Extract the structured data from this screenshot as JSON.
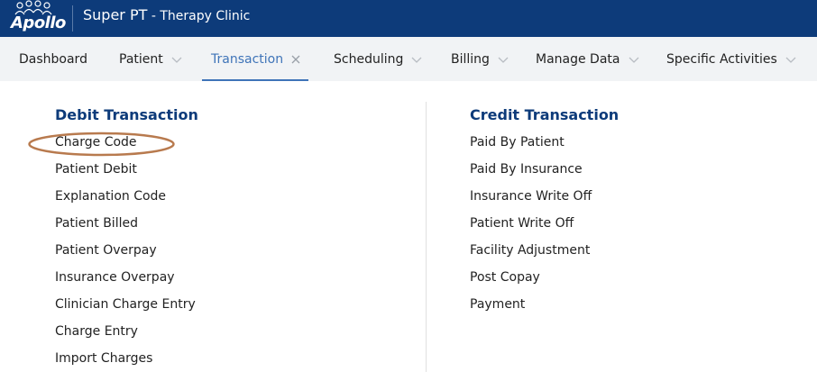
{
  "header": {
    "logo_text": "Apollo",
    "app_name": "Super PT",
    "app_subtitle": " - Therapy Clinic",
    "background_color": "#0d3b7a"
  },
  "nav": {
    "items": [
      {
        "label": "Dashboard",
        "has_chevron": false
      },
      {
        "label": "Patient",
        "has_chevron": true
      },
      {
        "label": "Transaction",
        "active": true,
        "icon": "close-icon"
      },
      {
        "label": "Scheduling",
        "has_chevron": true
      },
      {
        "label": "Billing",
        "has_chevron": true
      },
      {
        "label": "Manage Data",
        "has_chevron": true
      },
      {
        "label": "Specific Activities",
        "has_chevron": true
      }
    ],
    "active_color": "#3f74b8"
  },
  "menu": {
    "debit": {
      "title": "Debit Transaction",
      "items": [
        "Charge Code",
        "Patient Debit",
        "Explanation Code",
        "Patient Billed",
        "Patient Overpay",
        "Insurance Overpay",
        "Clinician Charge Entry",
        "Charge Entry",
        "Import Charges"
      ]
    },
    "credit": {
      "title": "Credit Transaction",
      "items": [
        "Paid By Patient",
        "Paid By Insurance",
        "Insurance Write Off",
        "Patient Write Off",
        "Facility Adjustment",
        "Post Copay",
        "Payment"
      ]
    },
    "highlighted_item": "Charge Code",
    "highlight_color": "#b87a4e"
  }
}
